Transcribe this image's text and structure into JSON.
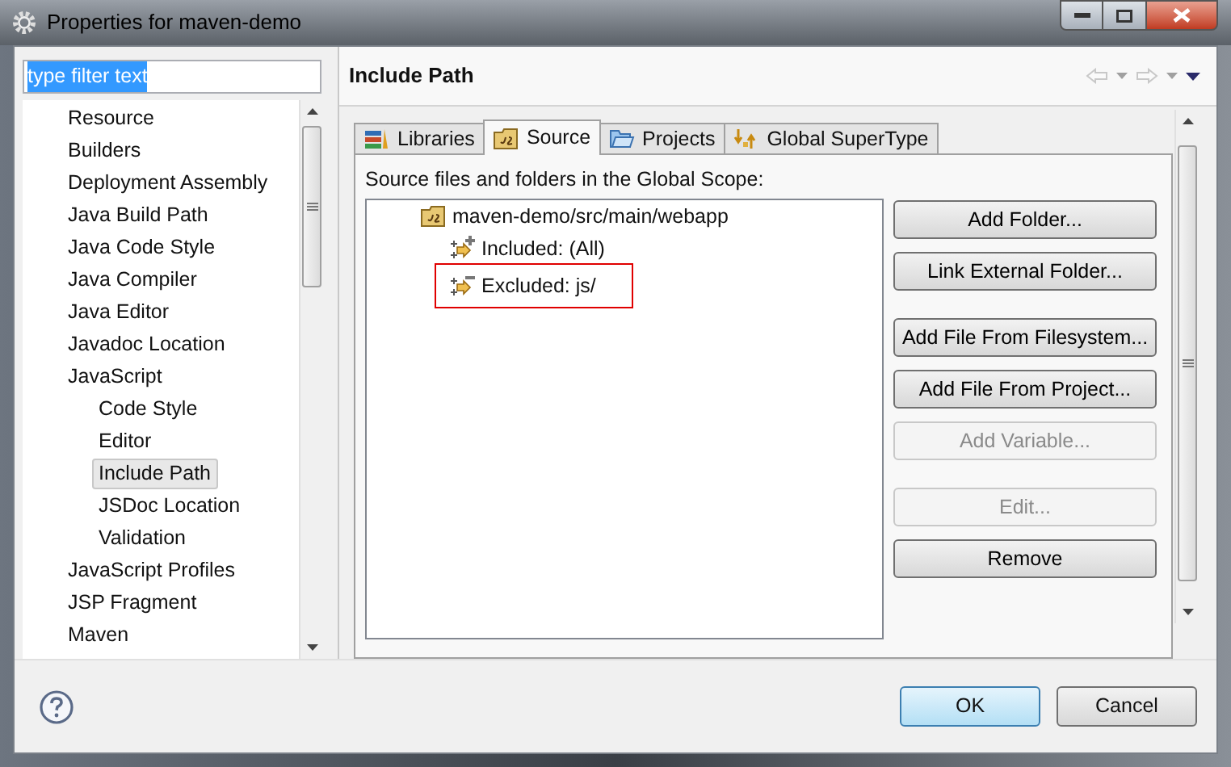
{
  "window": {
    "title": "Properties for maven-demo"
  },
  "filter": {
    "value": "type filter text",
    "text_selected": true
  },
  "nav_tree": [
    {
      "label": "Resource",
      "selected": false
    },
    {
      "label": "Builders",
      "selected": false
    },
    {
      "label": "Deployment Assembly",
      "selected": false
    },
    {
      "label": "Java Build Path",
      "selected": false
    },
    {
      "label": "Java Code Style",
      "selected": false
    },
    {
      "label": "Java Compiler",
      "selected": false
    },
    {
      "label": "Java Editor",
      "selected": false
    },
    {
      "label": "Javadoc Location",
      "selected": false
    },
    {
      "label": "JavaScript",
      "selected": false,
      "children": [
        {
          "label": "Code Style",
          "selected": false
        },
        {
          "label": "Editor",
          "selected": false
        },
        {
          "label": "Include Path",
          "selected": true
        },
        {
          "label": "JSDoc Location",
          "selected": false
        },
        {
          "label": "Validation",
          "selected": false
        }
      ]
    },
    {
      "label": "JavaScript Profiles",
      "selected": false
    },
    {
      "label": "JSP Fragment",
      "selected": false
    },
    {
      "label": "Maven",
      "selected": false
    }
  ],
  "page": {
    "title": "Include Path"
  },
  "tabs": [
    {
      "label": "Libraries",
      "kind": "books",
      "selected": false
    },
    {
      "label": "Source",
      "kind": "source",
      "selected": true
    },
    {
      "label": "Projects",
      "kind": "folder",
      "selected": false
    },
    {
      "label": "Global SuperType",
      "kind": "supertype",
      "selected": false
    }
  ],
  "source": {
    "label": "Source files and folders in the Global Scope:",
    "tree": [
      {
        "label": "maven-demo/src/main/webapp",
        "kind": "source",
        "highlighted": false,
        "children": [
          {
            "label": "Included: (All)",
            "kind": "included",
            "highlighted": false
          },
          {
            "label": "Excluded: js/",
            "kind": "excluded",
            "highlighted": true
          }
        ]
      }
    ]
  },
  "side_button_groups": [
    [
      {
        "label": "Add Folder...",
        "disabled": false
      },
      {
        "label": "Link External Folder...",
        "disabled": false
      }
    ],
    [
      {
        "label": "Add File From Filesystem...",
        "disabled": false
      },
      {
        "label": "Add File From Project...",
        "disabled": false
      },
      {
        "label": "Add Variable...",
        "disabled": true
      }
    ],
    [
      {
        "label": "Edit...",
        "disabled": true
      },
      {
        "label": "Remove",
        "disabled": false
      }
    ]
  ],
  "footer_buttons": [
    {
      "label": "OK",
      "default": true
    },
    {
      "label": "Cancel",
      "default": false
    }
  ]
}
